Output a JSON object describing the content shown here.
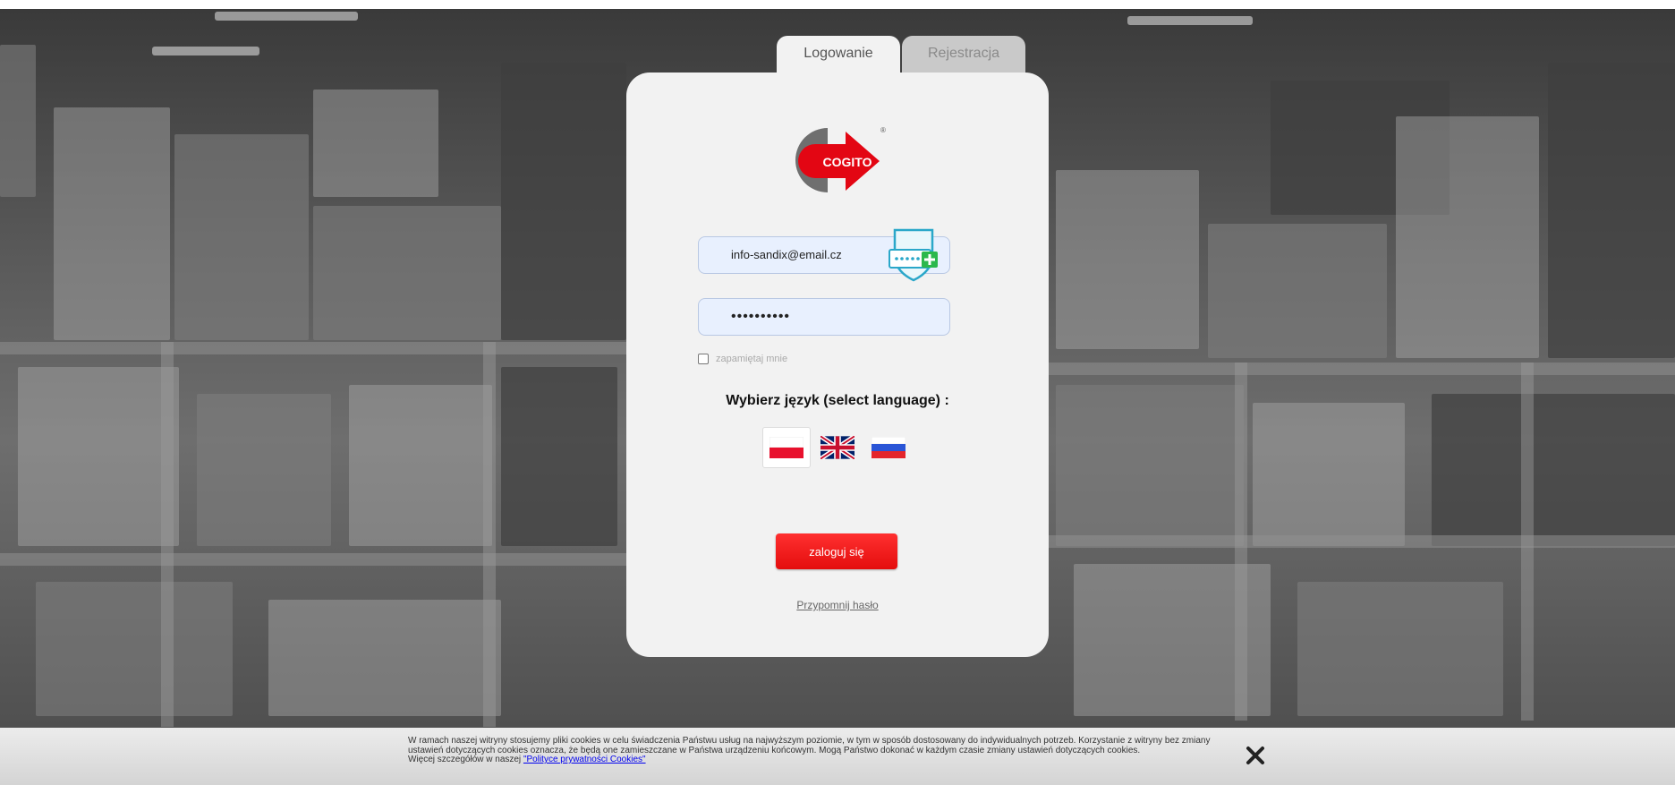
{
  "tabs": {
    "login": "Logowanie",
    "register": "Rejestracja"
  },
  "brand": {
    "logo_text": "COGITO",
    "registered_mark": "®",
    "red": "#e30613",
    "grey": "#6f6f6f"
  },
  "form": {
    "email_value": "info-sandix@email.cz",
    "password_value": "••••••••••",
    "remember_label": "zapamiętaj mnie",
    "remember_checked": false,
    "password_manager_icon": "password-manager-add-icon"
  },
  "language": {
    "title": "Wybierz język (select language) :",
    "flags": [
      {
        "code": "pl",
        "icon": "poland-flag-icon",
        "selected": true
      },
      {
        "code": "en",
        "icon": "uk-flag-icon",
        "selected": false
      },
      {
        "code": "ru",
        "icon": "russia-flag-icon",
        "selected": false
      }
    ]
  },
  "actions": {
    "login_button": "zaloguj się",
    "forgot_link": "Przypomnij hasło"
  },
  "cookie_bar": {
    "text": "W ramach naszej witryny stosujemy pliki cookies w celu świadczenia Państwu usług na najwyższym poziomie, w tym w sposób dostosowany do indywidualnych potrzeb. Korzystanie z witryny bez zmiany ustawień dotyczących cookies oznacza, że będą one zamieszczane w Państwa urządzeniu końcowym. Mogą Państwo dokonać w każdym czasie zmiany ustawień dotyczących cookies.",
    "more_prefix": "Więcej szczegółów w naszej",
    "policy_link": "\"Polityce prywatności Cookies\"",
    "close_icon": "close-icon"
  }
}
